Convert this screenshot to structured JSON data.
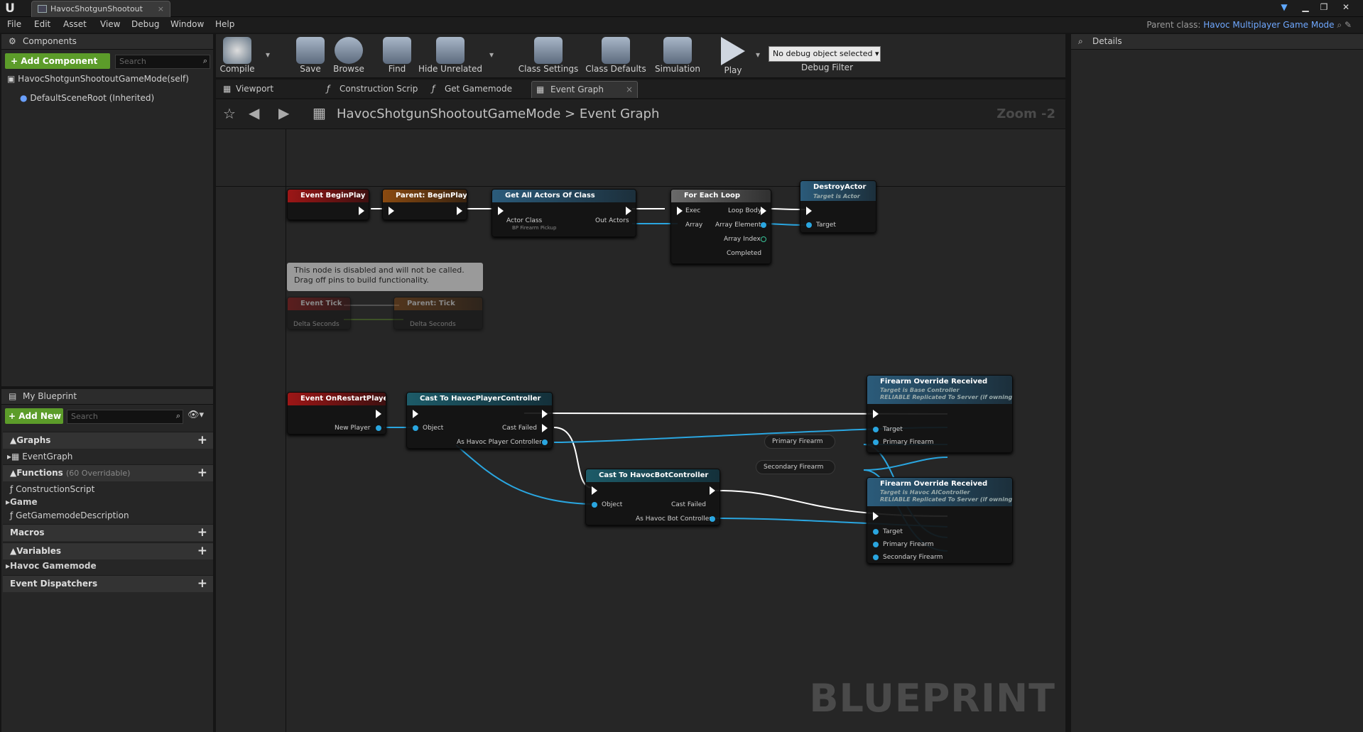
{
  "app": {
    "document_tab": "HavocShotgunShootout",
    "parent_class_label": "Parent class:",
    "parent_class_value": "Havoc Multiplayer Game Mode"
  },
  "menu": [
    "File",
    "Edit",
    "Asset",
    "View",
    "Debug",
    "Window",
    "Help"
  ],
  "components": {
    "title": "Components",
    "add_button": "+ Add Component",
    "search_placeholder": "Search",
    "tree": [
      "HavocShotgunShootoutGameMode(self)",
      "DefaultSceneRoot (Inherited)"
    ]
  },
  "my_blueprint": {
    "title": "My Blueprint",
    "add_button": "+ Add New",
    "search_placeholder": "Search",
    "graphs_label": "Graphs",
    "graphs_items": [
      "EventGraph"
    ],
    "functions_label": "Functions",
    "functions_note": "(60 Overridable)",
    "functions_items": [
      "ConstructionScript"
    ],
    "game_label": "Game",
    "game_items": [
      "GetGamemodeDescription"
    ],
    "macros_label": "Macros",
    "variables_label": "Variables",
    "variables_items": [
      "Havoc Gamemode"
    ],
    "dispatchers_label": "Event Dispatchers"
  },
  "toolbar": {
    "compile": "Compile",
    "save": "Save",
    "browse": "Browse",
    "find": "Find",
    "hide_unrelated": "Hide Unrelated",
    "class_settings": "Class Settings",
    "class_defaults": "Class Defaults",
    "simulation": "Simulation",
    "play": "Play",
    "debug_select": "No debug object selected",
    "debug_filter": "Debug Filter"
  },
  "editor_tabs": [
    "Viewport",
    "Construction Scrip",
    "Get Gamemode De",
    "Event Graph"
  ],
  "graph_bar": {
    "crumb_root": "HavocShotgunShootoutGameMode",
    "crumb_sep": ">",
    "crumb_leaf": "Event Graph",
    "zoom": "Zoom -2"
  },
  "details": {
    "title": "Details"
  },
  "watermark": "BLUEPRINT",
  "comment": {
    "text": "This node is disabled and will not be called. Drag off pins to build functionality."
  },
  "nodes": {
    "begin_play": "Event BeginPlay",
    "parent_begin_play": "Parent: BeginPlay",
    "get_all_actors": "Get All Actors Of Class",
    "actor_class": "Actor Class",
    "actor_class_value": "BP Firearm Pickup",
    "out_actors": "Out Actors",
    "for_each": "For Each Loop",
    "exec": "Exec",
    "array": "Array",
    "loop_body": "Loop Body",
    "array_element": "Array Element",
    "array_index": "Array Index",
    "completed": "Completed",
    "destroy_actor": "DestroyActor",
    "target_is_actor": "Target is Actor",
    "target": "Target",
    "event_tick": "Event Tick",
    "parent_tick": "Parent: Tick",
    "delta_seconds": "Delta Seconds",
    "on_restart": "Event OnRestartPlayer",
    "new_player": "New Player",
    "cast_player": "Cast To HavocPlayerController",
    "object": "Object",
    "cast_failed": "Cast Failed",
    "as_player": "As Havoc Player Controller",
    "cast_bot": "Cast To HavocBotController",
    "as_bot": "As Havoc Bot Controller",
    "override1_title": "Firearm Override Received",
    "override1_sub1": "Target is Base Controller",
    "override1_sub2": "RELIABLE Replicated To Server (if owning client)",
    "override2_title": "Firearm Override Received",
    "override2_sub1": "Target is Havoc AIController",
    "override2_sub2": "RELIABLE Replicated To Server (if owning client)",
    "primary_firearm": "Primary Firearm",
    "secondary_firearm": "Secondary Firearm"
  }
}
